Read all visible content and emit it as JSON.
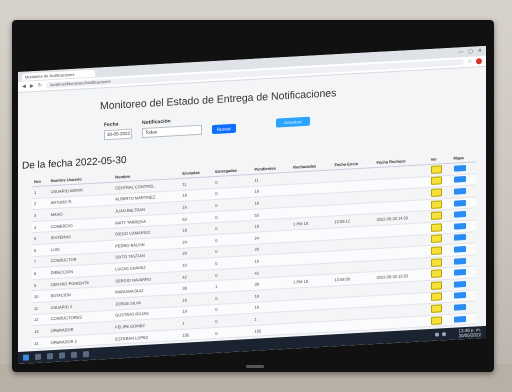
{
  "browser": {
    "tab_title": "Monitoreo de Notificaciones",
    "url": "localhost/Monitoreo/Notificaciones",
    "controls": [
      "—",
      "▢",
      "✕"
    ]
  },
  "page": {
    "title": "Monitoreo del Estado de Entrega de Notificaciones",
    "filters": {
      "date_label": "Fecha",
      "date_value": "30-05-2022",
      "notif_label": "Notificación",
      "notif_value": "Todas",
      "submit_label": "Buscar",
      "extra_button": "Actualizar"
    },
    "date_header": "De la fecha 2022-05-30",
    "table": {
      "columns": [
        "Nro",
        "Nombre Usuario",
        "Nombre",
        "Enviadas",
        "Entregadas",
        "Pendientes",
        "Rechazadas",
        "Fecha Envio",
        "Fecha Rechazo",
        "Ver",
        "Mapa"
      ],
      "rows": [
        [
          "1",
          "USUARIO ADMIN",
          "CENTRAL CONTROL",
          "11",
          "0",
          "11",
          "",
          "",
          "",
          "",
          ""
        ],
        [
          "2",
          "ARTURO R.",
          "ALBERTO MARTINEZ",
          "18",
          "0",
          "18",
          "",
          "",
          "",
          "",
          ""
        ],
        [
          "3",
          "MANO",
          "JUAN BELTRAN",
          "16",
          "0",
          "16",
          "",
          "",
          "",
          "",
          ""
        ],
        [
          "4",
          "COMERCIO",
          "MATT TARREGA",
          "53",
          "0",
          "53",
          "",
          "",
          "",
          "",
          ""
        ],
        [
          "5",
          "SISTEMAS",
          "DIEGO CAMARGO",
          "18",
          "0",
          "18",
          "1 PM 18",
          "13:09:12",
          "2022-05-30 14:03",
          "",
          ""
        ],
        [
          "6",
          "LUIS",
          "PEDRO BALVIN",
          "24",
          "0",
          "24",
          "",
          "",
          "",
          "",
          ""
        ],
        [
          "7",
          "CONDUCTOR",
          "SIXTO TASTIAN",
          "28",
          "0",
          "28",
          "",
          "",
          "",
          "",
          ""
        ],
        [
          "8",
          "DIRECCION",
          "LUCAS CHAVEZ",
          "10",
          "0",
          "10",
          "",
          "",
          "",
          "",
          ""
        ],
        [
          "9",
          "CENTRO PONIENTE",
          "SERGIO NAVARRO",
          "42",
          "0",
          "42",
          "",
          "",
          "",
          "",
          ""
        ],
        [
          "10",
          "ESTACION",
          "MARIANA DIAZ",
          "38",
          "1",
          "38",
          "1 PM 18",
          "13:08:09",
          "2022-05-30 13:53",
          "",
          ""
        ],
        [
          "11",
          "USUARIO 2",
          "JORGE SILVA",
          "18",
          "0",
          "18",
          "",
          "",
          "",
          "",
          ""
        ],
        [
          "12",
          "CONDUCTORES",
          "GUSTAVO ROJAS",
          "19",
          "0",
          "19",
          "",
          "",
          "",
          "",
          ""
        ],
        [
          "13",
          "OPERADOR",
          "FELIPE GOMEZ",
          "1",
          "0",
          "1",
          "",
          "",
          "",
          "",
          ""
        ],
        [
          "14",
          "OPERADOR 2",
          "ESTEBAN LOPEZ",
          "155",
          "0",
          "155",
          "",
          "",
          "",
          "",
          ""
        ]
      ]
    }
  },
  "taskbar": {
    "time": "13:48 p. m.",
    "date": "30/05/2022"
  },
  "colors": {
    "yellow_btn": "#f6e13a",
    "blue_btn": "#2a8cf5",
    "primary": "#0d6efd"
  }
}
